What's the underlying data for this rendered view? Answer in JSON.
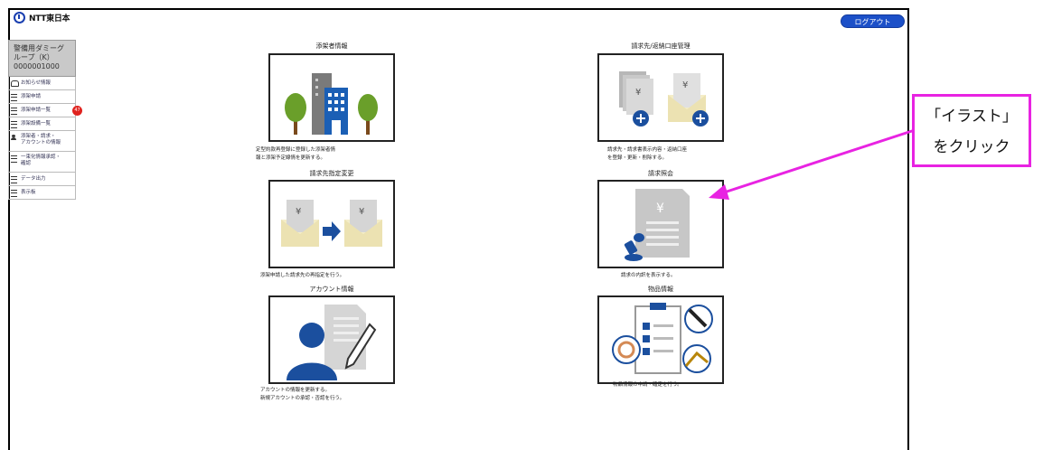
{
  "header": {
    "logo_text": "NTT東日本",
    "logout_label": "ログアウト"
  },
  "sidebar": {
    "user_line1": "警備用ダミーグ",
    "user_line2": "ループ（K）",
    "user_id": "0000001000",
    "items": [
      {
        "label": "お知らせ情報",
        "icon": "bell-icon"
      },
      {
        "label": "添架申請",
        "icon": "list-icon"
      },
      {
        "label": "添架申請一覧",
        "icon": "list-icon",
        "badge": "47"
      },
      {
        "label": "添架設備一覧",
        "icon": "list-icon"
      },
      {
        "label": "添架者・請求・",
        "label2": "アカウントの情報",
        "icon": "person-icon"
      },
      {
        "label": "一束化情報承認・",
        "label2": "確認",
        "icon": "list-icon"
      },
      {
        "label": "データ出力",
        "icon": "list-icon"
      },
      {
        "label": "表示板",
        "icon": "list-icon"
      }
    ]
  },
  "cards": [
    {
      "title": "添架者情報",
      "desc1": "定型約款再登録に登録した添架者情",
      "desc2": "報と添架予定線情を更新する。",
      "icon": "building-trees-icon"
    },
    {
      "title": "請求先/返納口座管理",
      "desc1": "請求先・請求書表示内容・返納口座",
      "desc2": "を登録・更新・削除する。",
      "icon": "invoice-envelope-add-icon"
    },
    {
      "title": "請求先指定変更",
      "desc1": "添架申請した請求先の再指定を行う。",
      "desc2": "",
      "icon": "envelope-transfer-icon"
    },
    {
      "title": "請求照会",
      "desc1": "請求の内訳を表示する。",
      "desc2": "",
      "icon": "invoice-stamp-icon"
    },
    {
      "title": "アカウント情報",
      "desc1": "アカウントの情報を更新する。",
      "desc2": "新規アカウントの承認・否認を行う。",
      "icon": "account-document-icon"
    },
    {
      "title": "物品情報",
      "desc1": "物品情報の申請・確定を行う。",
      "desc2": "",
      "icon": "checklist-cable-icon"
    }
  ],
  "annotation": {
    "line1": "「イラスト」",
    "line2": "をクリック",
    "color": "#e823e2"
  }
}
